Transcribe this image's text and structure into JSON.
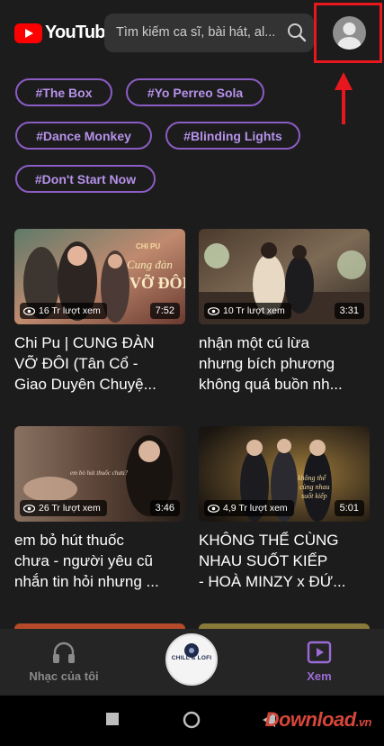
{
  "header": {
    "logo_text": "YouTube",
    "search_placeholder": "Tìm kiếm ca sĩ, bài hát, al..."
  },
  "tags": [
    "#The Box",
    "#Yo Perreo Sola",
    "#Dance Monkey",
    "#Blinding Lights",
    "#Don't Start Now"
  ],
  "videos": [
    {
      "views": "16 Tr lượt xem",
      "duration": "7:52",
      "title_lines": [
        "Chi Pu | CUNG ĐÀN",
        "VỠ ĐÔI (Tân Cổ -",
        "Giao Duyên Chuyệ..."
      ],
      "thumb_text": [
        "CHI PU",
        "Cung đàn",
        "VỠ ĐÔI"
      ]
    },
    {
      "views": "10 Tr lượt xem",
      "duration": "3:31",
      "title_lines": [
        "nhận một cú lừa",
        "nhưng bích phương",
        "không quá buồn nh..."
      ]
    },
    {
      "views": "26 Tr lượt xem",
      "duration": "3:46",
      "title_lines": [
        "em bỏ hút thuốc",
        "chưa - người yêu cũ",
        "nhắn tin hỏi nhưng ..."
      ],
      "thumb_text": [
        "em bỏ hút thuốc chưa?"
      ]
    },
    {
      "views": "4,9 Tr lượt xem",
      "duration": "5:01",
      "title_lines": [
        "KHÔNG THỂ CÙNG",
        "NHAU SUỐT KIẾP",
        "- HOÀ MINZY x ĐỨ..."
      ],
      "thumb_text": [
        "không thể",
        "cùng nhau",
        "suốt kiếp"
      ]
    }
  ],
  "bottom_nav": {
    "left_label": "Nhạc của tôi",
    "right_label": "Xem",
    "now_playing_text": "CHILL & LOFI",
    "accent_color": "#9b6bd6",
    "inactive_color": "#8a8a8a"
  },
  "icons": [
    "search-icon",
    "avatar-icon",
    "headphones-icon",
    "play-box-icon",
    "eye-icon",
    "square-icon",
    "circle-icon",
    "triangle-back-icon"
  ],
  "watermark": {
    "text": "Download",
    "suffix": ".vn"
  }
}
